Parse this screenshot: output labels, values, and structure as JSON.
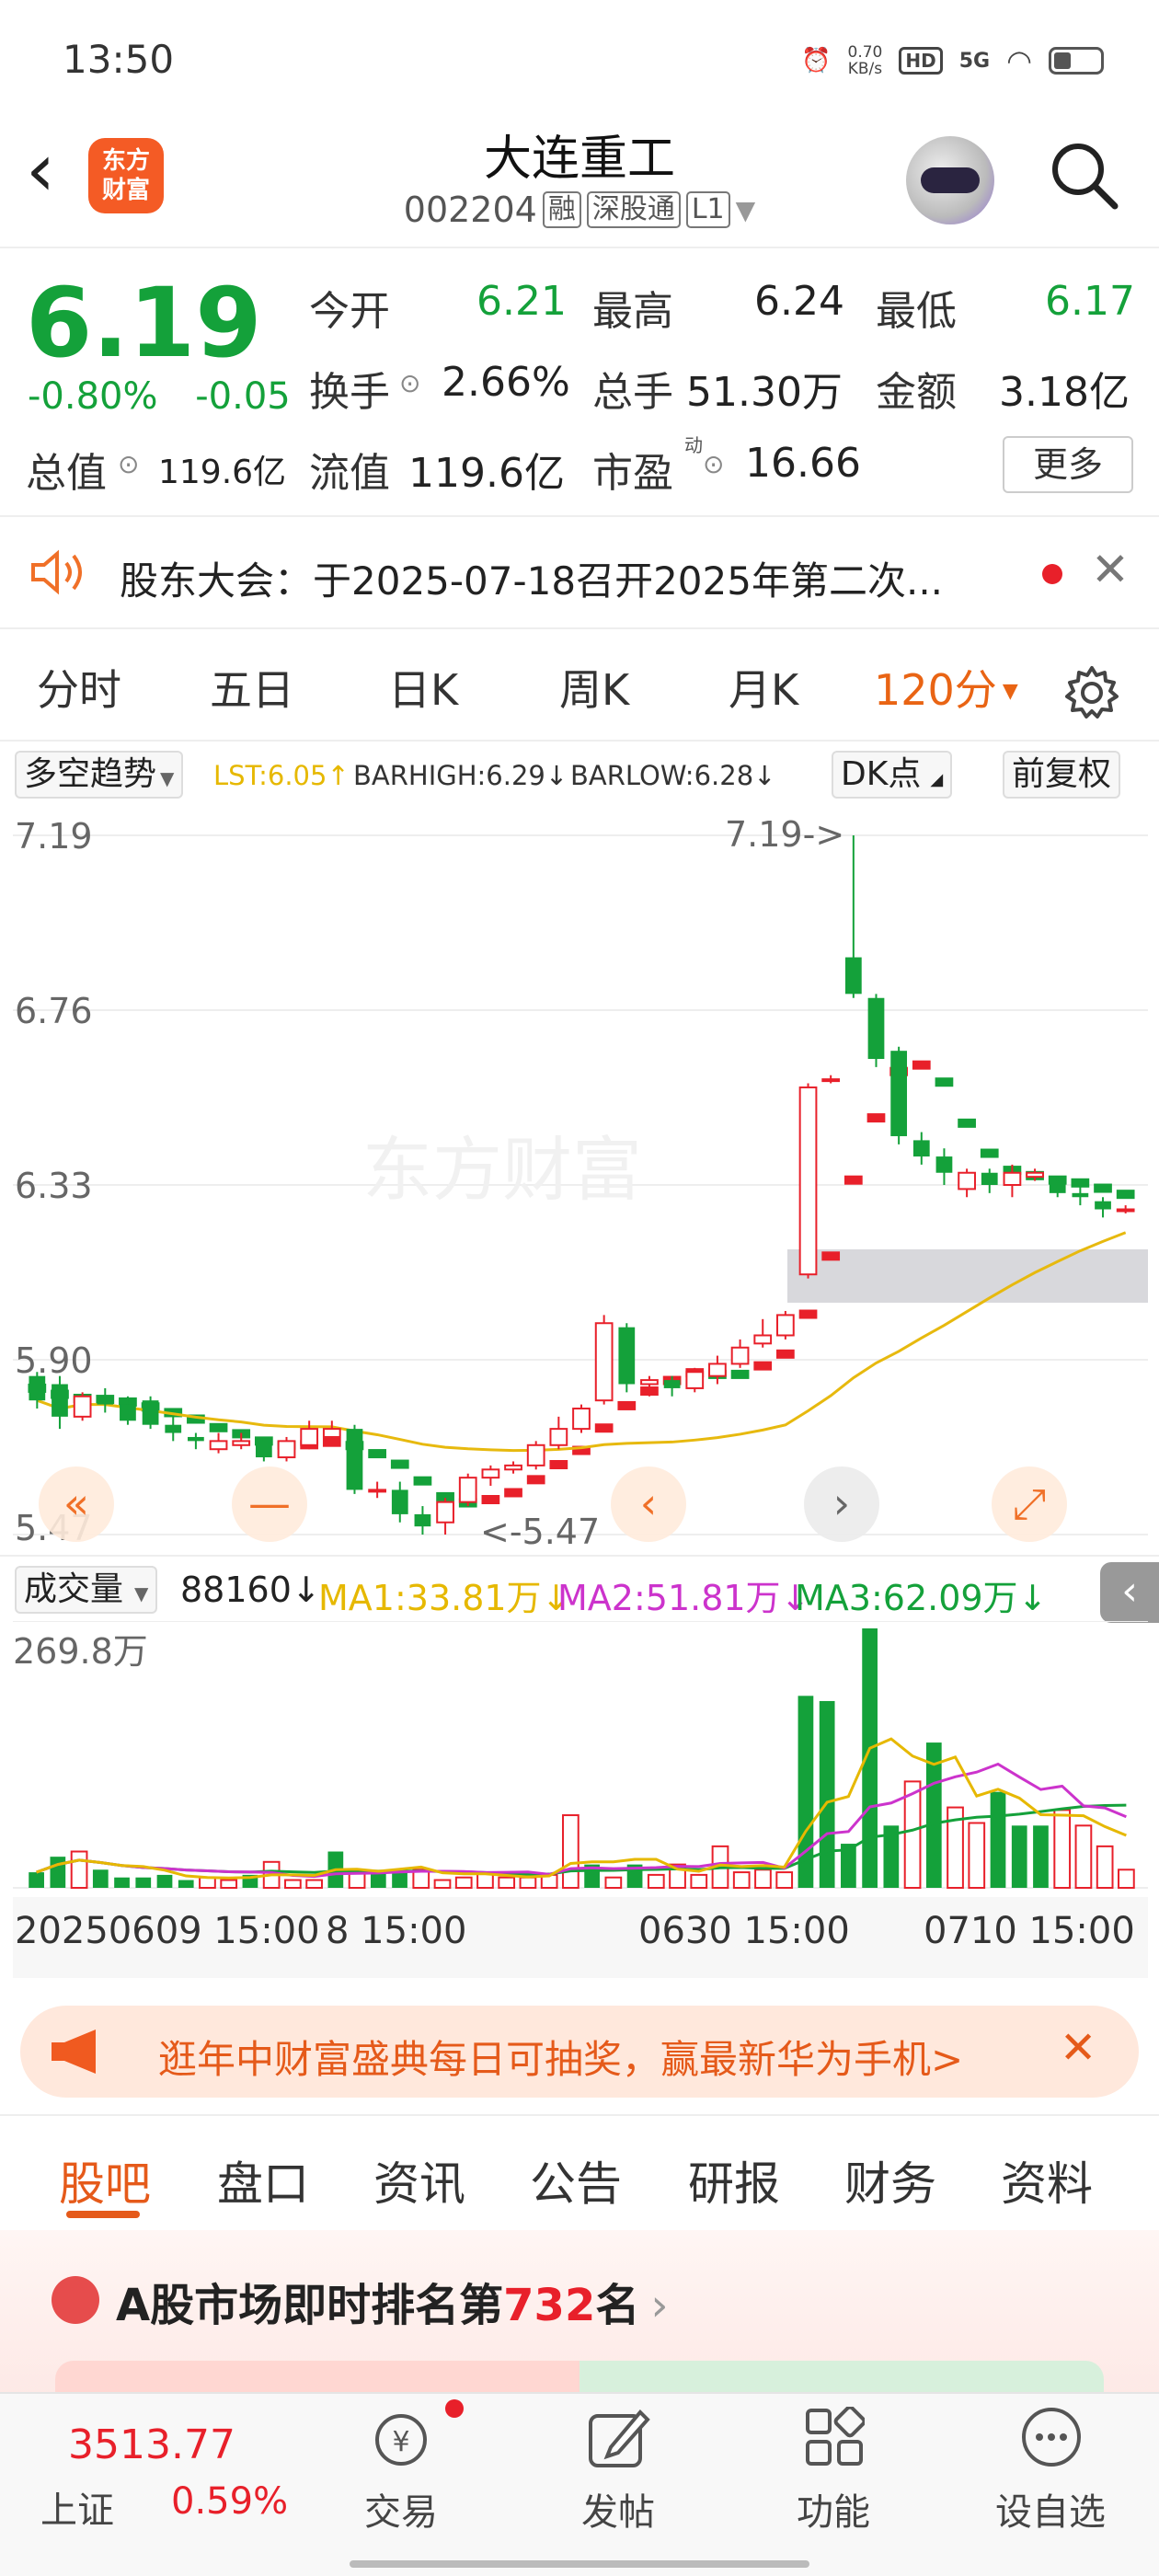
{
  "status_bar": {
    "time": "13:50",
    "net_speed_value": "0.70",
    "net_speed_unit": "KB/s",
    "hd": "HD",
    "signal": "5G"
  },
  "header": {
    "back_glyph": "‹",
    "logo_line1": "东方",
    "logo_line2": "财富",
    "stock_name": "大连重工",
    "stock_code": "002204",
    "tags": [
      "融",
      "深股通",
      "L1"
    ]
  },
  "quote": {
    "price": "6.19",
    "change_pct": "-0.80%",
    "change": "-0.05",
    "open_label": "今开",
    "open": "6.21",
    "high_label": "最高",
    "high": "6.24",
    "low_label": "最低",
    "low": "6.17",
    "turnover_label": "换手",
    "turnover": "2.66%",
    "volume_label": "总手",
    "volume": "51.30万",
    "amount_label": "金额",
    "amount": "3.18亿",
    "mktcap_label": "总值",
    "mktcap": "119.6亿",
    "float_label": "流值",
    "float_cap": "119.6亿",
    "pe_label": "市盈",
    "pe_sup": "动",
    "pe": "16.66",
    "more_label": "更多"
  },
  "notice": {
    "text": "股东大会：于2025-07-18召开2025年第二次...",
    "close": "✕"
  },
  "period_tabs": [
    "分时",
    "五日",
    "日K",
    "周K",
    "月K",
    "120分"
  ],
  "indicator": {
    "selector": "多空趋势",
    "lst": "LST:6.05",
    "barhigh": "BARHIGH:6.29",
    "barlow": "BARLOW:6.28",
    "dk_label": "DK点",
    "adjust_label": "前复权"
  },
  "chart_data": {
    "type": "candlestick",
    "ylabels": [
      "7.19",
      "6.76",
      "6.33",
      "5.90",
      "5.47"
    ],
    "max_marker": "7.19->",
    "min_marker": "<-5.47",
    "watermark": "东方财富",
    "candles": [
      {
        "o": 5.86,
        "c": 5.8,
        "h": 5.87,
        "l": 5.78
      },
      {
        "o": 5.84,
        "c": 5.76,
        "h": 5.86,
        "l": 5.73
      },
      {
        "o": 5.76,
        "c": 5.81,
        "h": 5.82,
        "l": 5.75
      },
      {
        "o": 5.8,
        "c": 5.79,
        "h": 5.83,
        "l": 5.77
      },
      {
        "o": 5.79,
        "c": 5.75,
        "h": 5.81,
        "l": 5.74
      },
      {
        "o": 5.8,
        "c": 5.74,
        "h": 5.81,
        "l": 5.73
      },
      {
        "o": 5.74,
        "c": 5.72,
        "h": 5.76,
        "l": 5.7
      },
      {
        "o": 5.71,
        "c": 5.7,
        "h": 5.72,
        "l": 5.68
      },
      {
        "o": 5.68,
        "c": 5.7,
        "h": 5.72,
        "l": 5.67
      },
      {
        "o": 5.69,
        "c": 5.7,
        "h": 5.72,
        "l": 5.68
      },
      {
        "o": 5.7,
        "c": 5.66,
        "h": 5.71,
        "l": 5.65
      },
      {
        "o": 5.66,
        "c": 5.7,
        "h": 5.71,
        "l": 5.65
      },
      {
        "o": 5.69,
        "c": 5.73,
        "h": 5.75,
        "l": 5.68
      },
      {
        "o": 5.71,
        "c": 5.73,
        "h": 5.75,
        "l": 5.7
      },
      {
        "o": 5.73,
        "c": 5.58,
        "h": 5.74,
        "l": 5.57
      },
      {
        "o": 5.58,
        "c": 5.58,
        "h": 5.6,
        "l": 5.56
      },
      {
        "o": 5.58,
        "c": 5.52,
        "h": 5.6,
        "l": 5.5
      },
      {
        "o": 5.52,
        "c": 5.49,
        "h": 5.54,
        "l": 5.47
      },
      {
        "o": 5.5,
        "c": 5.55,
        "h": 5.56,
        "l": 5.47
      },
      {
        "o": 5.55,
        "c": 5.61,
        "h": 5.62,
        "l": 5.54
      },
      {
        "o": 5.61,
        "c": 5.63,
        "h": 5.64,
        "l": 5.59
      },
      {
        "o": 5.63,
        "c": 5.64,
        "h": 5.65,
        "l": 5.62
      },
      {
        "o": 5.64,
        "c": 5.69,
        "h": 5.7,
        "l": 5.63
      },
      {
        "o": 5.69,
        "c": 5.73,
        "h": 5.76,
        "l": 5.68
      },
      {
        "o": 5.73,
        "c": 5.78,
        "h": 5.79,
        "l": 5.72
      },
      {
        "o": 5.8,
        "c": 5.99,
        "h": 6.01,
        "l": 5.79
      },
      {
        "o": 5.98,
        "c": 5.84,
        "h": 5.99,
        "l": 5.82
      },
      {
        "o": 5.84,
        "c": 5.85,
        "h": 5.86,
        "l": 5.81
      },
      {
        "o": 5.85,
        "c": 5.83,
        "h": 5.86,
        "l": 5.81
      },
      {
        "o": 5.83,
        "c": 5.87,
        "h": 5.88,
        "l": 5.82
      },
      {
        "o": 5.86,
        "c": 5.89,
        "h": 5.91,
        "l": 5.84
      },
      {
        "o": 5.89,
        "c": 5.93,
        "h": 5.95,
        "l": 5.88
      },
      {
        "o": 5.94,
        "c": 5.96,
        "h": 6.0,
        "l": 5.93
      },
      {
        "o": 5.96,
        "c": 6.01,
        "h": 6.02,
        "l": 5.95
      },
      {
        "o": 6.11,
        "c": 6.57,
        "h": 6.58,
        "l": 6.1
      },
      {
        "o": 6.59,
        "c": 6.59,
        "h": 6.6,
        "l": 6.58
      },
      {
        "o": 6.89,
        "c": 6.8,
        "h": 7.19,
        "l": 6.79
      },
      {
        "o": 6.79,
        "c": 6.64,
        "h": 6.8,
        "l": 6.62
      },
      {
        "o": 6.66,
        "c": 6.45,
        "h": 6.67,
        "l": 6.43
      },
      {
        "o": 6.44,
        "c": 6.4,
        "h": 6.46,
        "l": 6.38
      },
      {
        "o": 6.4,
        "c": 6.36,
        "h": 6.42,
        "l": 6.33
      },
      {
        "o": 6.32,
        "c": 6.36,
        "h": 6.37,
        "l": 6.3
      },
      {
        "o": 6.36,
        "c": 6.33,
        "h": 6.37,
        "l": 6.31
      },
      {
        "o": 6.33,
        "c": 6.36,
        "h": 6.38,
        "l": 6.3
      },
      {
        "o": 6.35,
        "c": 6.36,
        "h": 6.37,
        "l": 6.34
      },
      {
        "o": 6.34,
        "c": 6.31,
        "h": 6.35,
        "l": 6.3
      },
      {
        "o": 6.31,
        "c": 6.3,
        "h": 6.33,
        "l": 6.28
      },
      {
        "o": 6.29,
        "c": 6.27,
        "h": 6.3,
        "l": 6.25
      },
      {
        "o": 6.27,
        "c": 6.27,
        "h": 6.28,
        "l": 6.26
      }
    ]
  },
  "volume": {
    "selector": "成交量",
    "value": "88160",
    "ma1": "MA1:33.81万",
    "ma2": "MA2:51.81万",
    "ma3": "MA3:62.09万",
    "ylabel": "269.8万",
    "dates": [
      "20250609 15:00",
      "8 15:00",
      "0630 15:00",
      "0710 15:00"
    ],
    "values": [
      6,
      12,
      14,
      7,
      4,
      4,
      5,
      3,
      4,
      3,
      5,
      10,
      3,
      3,
      14,
      6,
      6,
      7,
      7,
      3,
      4,
      6,
      4,
      4,
      5,
      28,
      9,
      4,
      9,
      5,
      9,
      5,
      16,
      6,
      7,
      6,
      74,
      72,
      17,
      100,
      24,
      41,
      56,
      31,
      25,
      37,
      24,
      24,
      30,
      24,
      16,
      7
    ]
  },
  "promo": {
    "text": "逛年中财富盛典每日可抽奖，赢最新华为手机>",
    "close": "✕"
  },
  "content_tabs": [
    "股吧",
    "盘口",
    "资讯",
    "公告",
    "研报",
    "财务",
    "资料"
  ],
  "rank": {
    "prefix": "A股市场即时排名第",
    "number": "732",
    "suffix": "名"
  },
  "bottom_nav": {
    "index_value": "3513.77",
    "index_name": "上证",
    "index_change": "0.59%",
    "items": [
      "交易",
      "发帖",
      "功能",
      "设自选"
    ]
  },
  "colors": {
    "up": "#e8202a",
    "down": "#14a13a",
    "accent": "#e96414"
  }
}
